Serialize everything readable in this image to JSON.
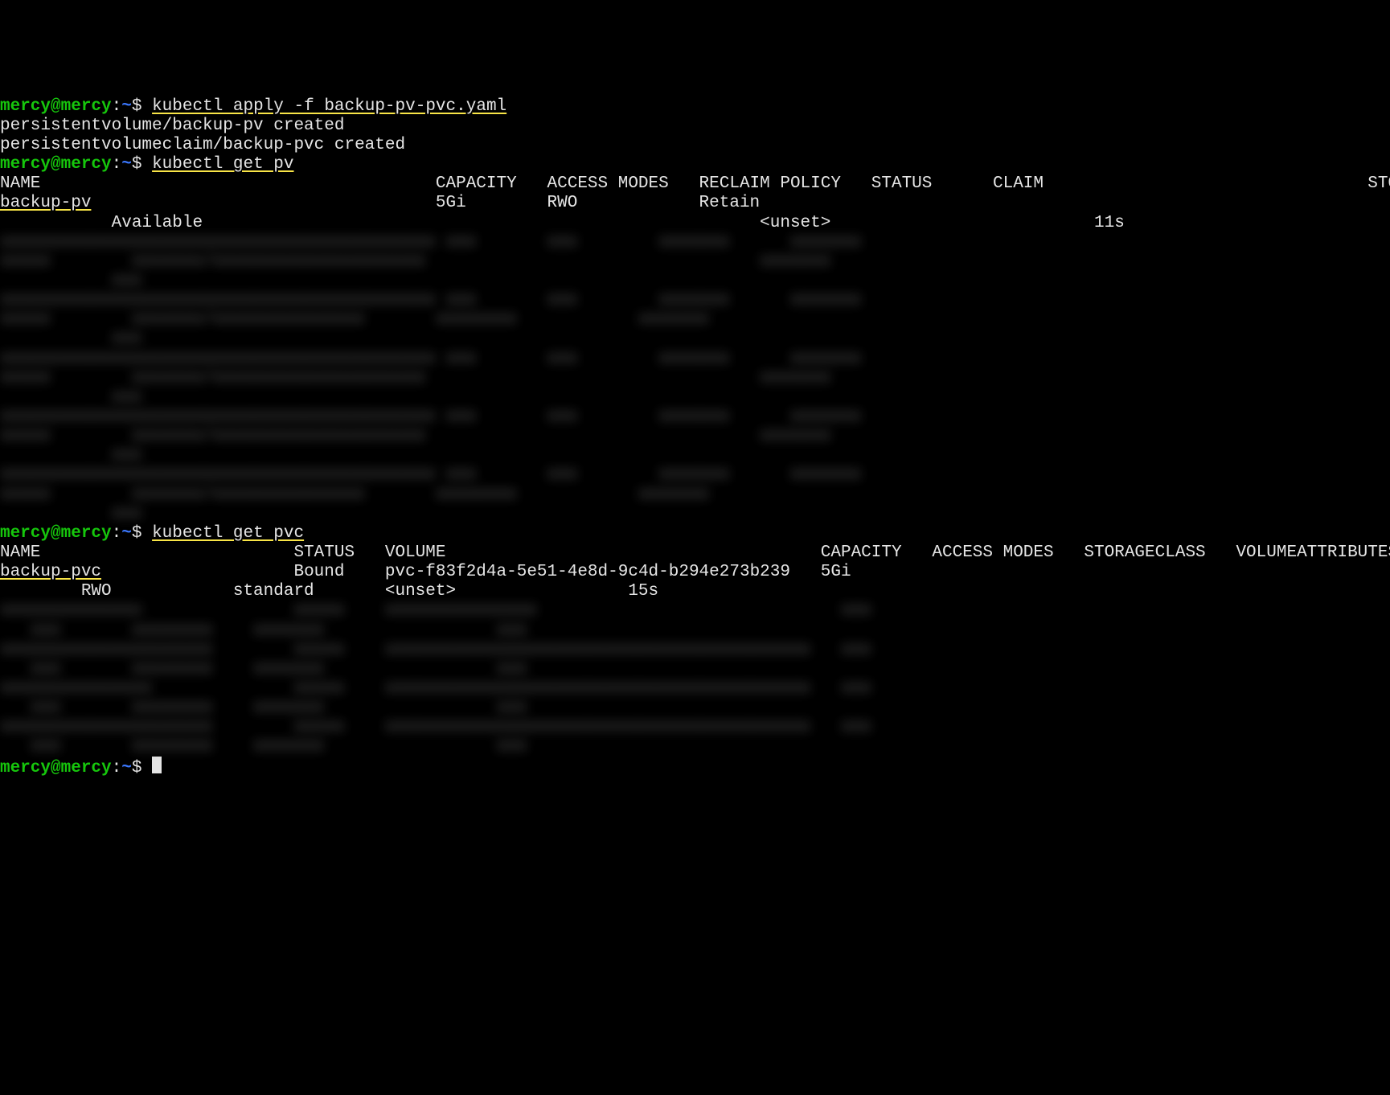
{
  "prompt": {
    "user": "mercy",
    "host": "mercy",
    "sep_at": "@",
    "sep_colon": ":",
    "path": "~",
    "dollar": "$"
  },
  "cmd1": "kubectl apply -f backup-pv-pvc.yaml",
  "out1_line1": "persistentvolume/backup-pv created",
  "out1_line2": "persistentvolumeclaim/backup-pvc created",
  "cmd2": "kubectl get pv",
  "out2_header": "NAME                                       CAPACITY   ACCESS MODES   RECLAIM POLICY   STATUS      CLAIM                                STORAGECLASS   VOLUMEATTRIBUTESCLASS   REASON   AGE",
  "out2_row_name": "backup-pv",
  "out2_row_rest1": "                                  5Gi        RWO            Retain",
  "out2_row_line2": "           Available                                                       <unset>                          11s",
  "blur2": "xxxxxxxxxxxxxxxxxxxxxxxxxxxxxxxxxxxxxxxxxxx xxx       xxx        xxxxxxx      xxxxxxx\nxxxxx        xxxxxxx/xxxxxxxxxxxxxxxxxxxxx                                 xxxxxxx\n           xxx\nxxxxxxxxxxxxxxxxxxxxxxxxxxxxxxxxxxxxxxxxxxx xxx       xxx        xxxxxxx      xxxxxxx\nxxxxx        xxxxxxx/xxxxxxxxxxxxxxx       xxxxxxxx            xxxxxxx\n           xxx\nxxxxxxxxxxxxxxxxxxxxxxxxxxxxxxxxxxxxxxxxxxx xxx       xxx        xxxxxxx      xxxxxxx\nxxxxx        xxxxxxx/xxxxxxxxxxxxxxxxxxxxx                                 xxxxxxx\n           xxx\nxxxxxxxxxxxxxxxxxxxxxxxxxxxxxxxxxxxxxxxxxxx xxx       xxx        xxxxxxx      xxxxxxx\nxxxxx        xxxxxxx/xxxxxxxxxxxxxxxxxxxxx                                 xxxxxxx\n           xxx\nxxxxxxxxxxxxxxxxxxxxxxxxxxxxxxxxxxxxxxxxxxx xxx       xxx        xxxxxxx      xxxxxxx\nxxxxx        xxxxxxx/xxxxxxxxxxxxxxx       xxxxxxxx            xxxxxxx\n           xxx",
  "cmd3": "kubectl get pvc",
  "out3_header": "NAME                         STATUS   VOLUME                                     CAPACITY   ACCESS MODES   STORAGECLASS   VOLUMEATTRIBUTESCLASS   AGE",
  "out3_row_name": "backup-pvc",
  "out3_row_rest1": "                   Bound    pvc-f83f2d4a-5e51-4e8d-9c4d-b294e273b239   5Gi",
  "out3_row_line2": "        RWO            standard       <unset>                 15s",
  "blur3": "xxxxxxxxxxxxxx               xxxxx    xxxxxxxxxxxxxxx                              xxx\n   xxx       xxxxxxxx    xxxxxxx                 xxx\nxxxxxxxxxxxxxxxxxxxxx        xxxxx    xxxxxxxxxxxxxxxxxxxxxxxxxxxxxxxxxxxxxxxxxx   xxx\n   xxx       xxxxxxxx    xxxxxxx                 xxx\nxxxxxxxxxxxxxxx              xxxxx    xxxxxxxxxxxxxxxxxxxxxxxxxxxxxxxxxxxxxxxxxx   xxx\n   xxx       xxxxxxxx    xxxxxxx                 xxx\nxxxxxxxxxxxxxxxxxxxxx        xxxxx    xxxxxxxxxxxxxxxxxxxxxxxxxxxxxxxxxxxxxxxxxx   xxx\n   xxx       xxxxxxxx    xxxxxxx                 xxx"
}
